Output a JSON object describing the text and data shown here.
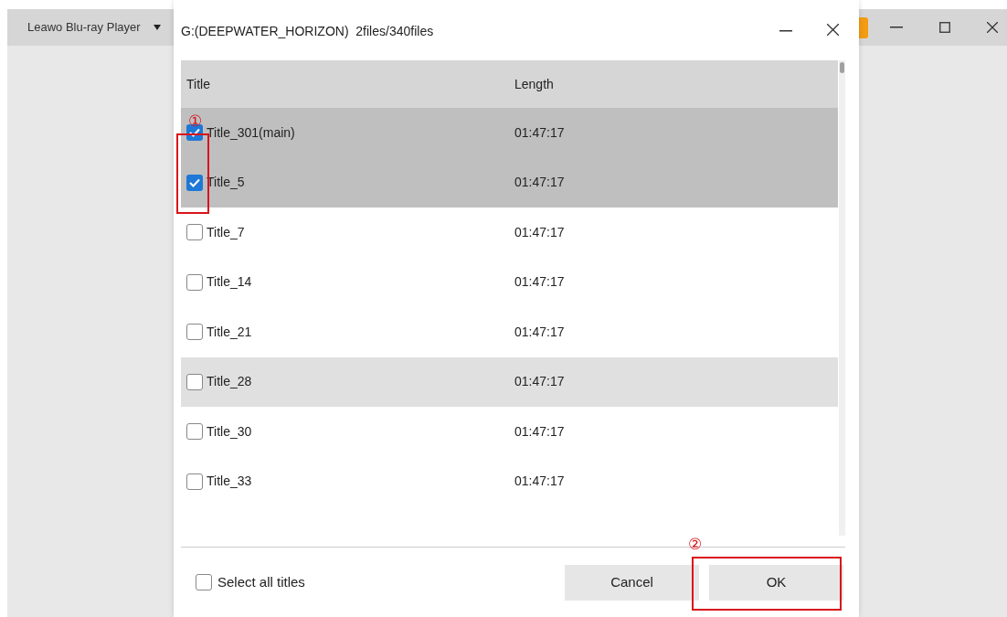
{
  "app_window": {
    "title": "Leawo Blu-ray Player"
  },
  "dialog": {
    "title": "G:(DEEPWATER_HORIZON)  2files/340files"
  },
  "table": {
    "columns": [
      "Title",
      "Length"
    ],
    "rows": [
      {
        "title": "Title_301(main)",
        "length": "01:47:17",
        "checked": true,
        "hovered": false
      },
      {
        "title": "Title_5",
        "length": "01:47:17",
        "checked": true,
        "hovered": false
      },
      {
        "title": "Title_7",
        "length": "01:47:17",
        "checked": false,
        "hovered": false
      },
      {
        "title": "Title_14",
        "length": "01:47:17",
        "checked": false,
        "hovered": false
      },
      {
        "title": "Title_21",
        "length": "01:47:17",
        "checked": false,
        "hovered": false
      },
      {
        "title": "Title_28",
        "length": "01:47:17",
        "checked": false,
        "hovered": true
      },
      {
        "title": "Title_30",
        "length": "01:47:17",
        "checked": false,
        "hovered": false
      },
      {
        "title": "Title_33",
        "length": "01:47:17",
        "checked": false,
        "hovered": false
      }
    ]
  },
  "select_all": {
    "label": "Select all titles",
    "checked": false
  },
  "buttons": [
    "Cancel",
    "OK"
  ],
  "annotations": [
    "①",
    "②"
  ]
}
